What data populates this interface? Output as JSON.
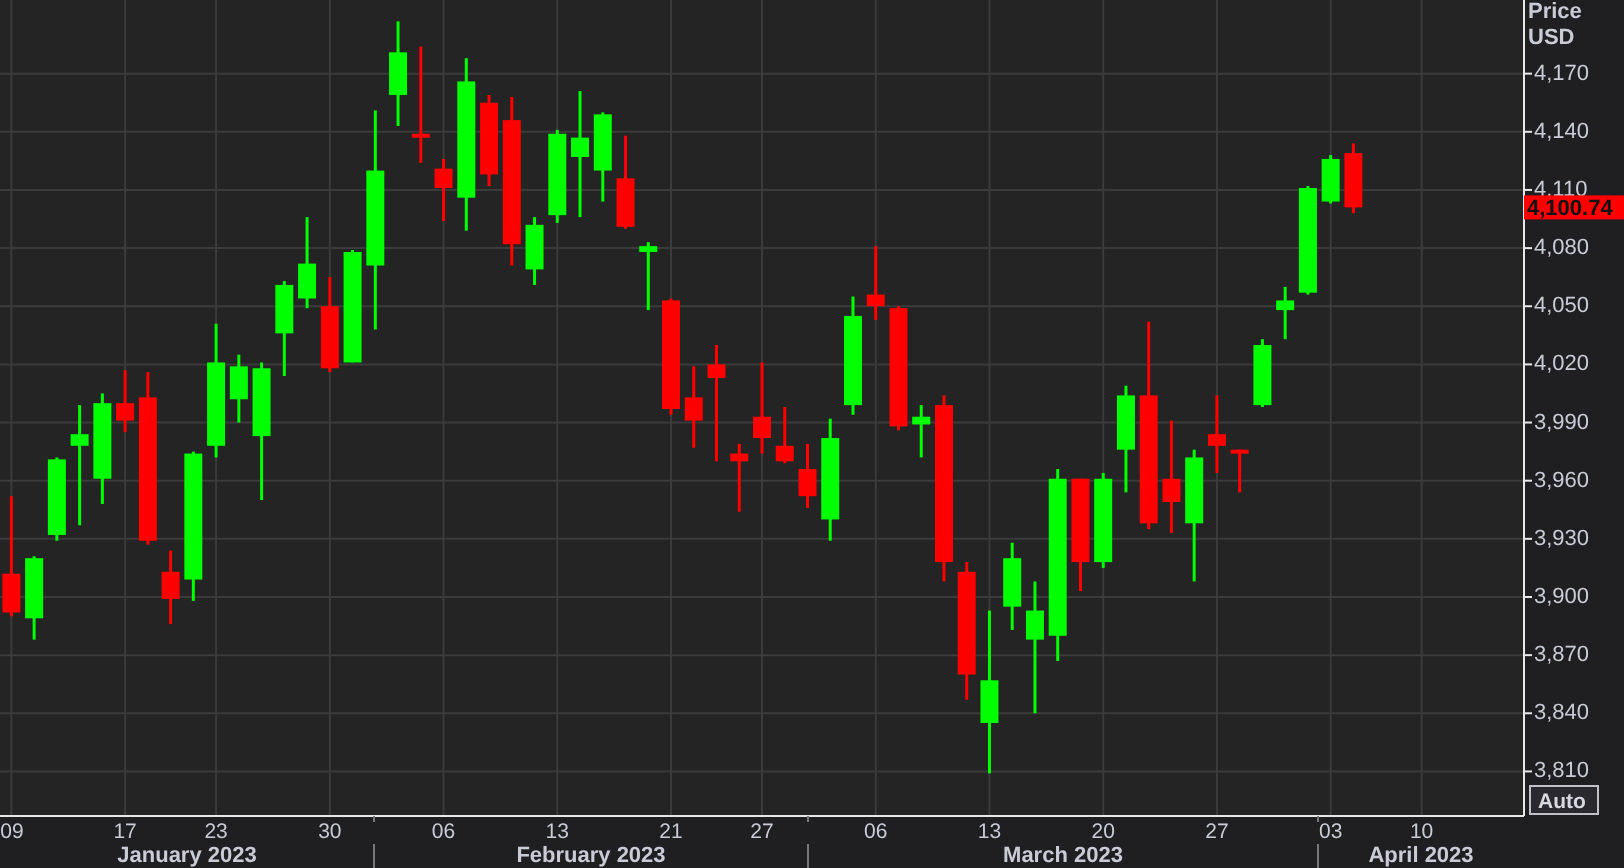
{
  "chart_data": {
    "type": "candlestick",
    "ylabel": "Price USD",
    "grid": true,
    "categories": [
      "09",
      null,
      null,
      null,
      null,
      "17",
      null,
      null,
      null,
      "23",
      null,
      null,
      null,
      null,
      "30",
      null,
      null,
      null,
      null,
      "06",
      null,
      null,
      null,
      null,
      "13",
      null,
      null,
      null,
      null,
      "21",
      null,
      null,
      null,
      "27",
      null,
      null,
      null,
      null,
      "06",
      null,
      null,
      null,
      null,
      "13",
      null,
      null,
      null,
      null,
      "20",
      null,
      null,
      null,
      null,
      "27",
      null,
      null,
      null,
      null,
      "03",
      null,
      null,
      null,
      "10",
      null,
      null,
      null,
      null
    ],
    "ohlc": [
      [
        3912,
        3952,
        3890,
        3892
      ],
      [
        3889,
        3921,
        3878,
        3920
      ],
      [
        3932,
        3972,
        3929,
        3971
      ],
      [
        3978,
        3999,
        3937,
        3984
      ],
      [
        3961,
        4005,
        3948,
        4000
      ],
      [
        4000,
        4017,
        3985,
        3991
      ],
      [
        4003,
        4016,
        3927,
        3929
      ],
      [
        3913,
        3924,
        3886,
        3899
      ],
      [
        3909,
        3975,
        3898,
        3974
      ],
      [
        3978,
        4041,
        3972,
        4021
      ],
      [
        4002,
        4025,
        3990,
        4019
      ],
      [
        3983,
        4021,
        3950,
        4018
      ],
      [
        4036,
        4063,
        4014,
        4061
      ],
      [
        4054,
        4096,
        4049,
        4072
      ],
      [
        4050,
        4065,
        4016,
        4018
      ],
      [
        4021,
        4079,
        4021,
        4078
      ],
      [
        4071,
        4151,
        4038,
        4120
      ],
      [
        4159,
        4197,
        4143,
        4181
      ],
      [
        4139,
        4184,
        4124,
        4137
      ],
      [
        4121,
        4126,
        4094,
        4111
      ],
      [
        4106,
        4178,
        4089,
        4166
      ],
      [
        4155,
        4159,
        4112,
        4118
      ],
      [
        4146,
        4158,
        4071,
        4082
      ],
      [
        4069,
        4096,
        4061,
        4092
      ],
      [
        4097,
        4141,
        4093,
        4139
      ],
      [
        4127,
        4161,
        4096,
        4137
      ],
      [
        4120,
        4150,
        4104,
        4149
      ],
      [
        4116,
        4138,
        4090,
        4091
      ],
      [
        4078,
        4083,
        4048,
        4081
      ],
      [
        4053,
        4054,
        3994,
        3997
      ],
      [
        4003,
        4019,
        3977,
        3991
      ],
      [
        4020,
        4030,
        3970,
        4013
      ],
      [
        3974,
        3979,
        3944,
        3970
      ],
      [
        3993,
        4021,
        3974,
        3982
      ],
      [
        3978,
        3998,
        3969,
        3970
      ],
      [
        3966,
        3979,
        3946,
        3952
      ],
      [
        3940,
        3992,
        3929,
        3982
      ],
      [
        3999,
        4055,
        3994,
        4045
      ],
      [
        4056,
        4081,
        4043,
        4050
      ],
      [
        4049,
        4050,
        3986,
        3988
      ],
      [
        3989,
        3999,
        3972,
        3993
      ],
      [
        3999,
        4004,
        3908,
        3918
      ],
      [
        3913,
        3918,
        3847,
        3860
      ],
      [
        3835,
        3893,
        3809,
        3857
      ],
      [
        3895,
        3928,
        3883,
        3920
      ],
      [
        3878,
        3908,
        3840,
        3893
      ],
      [
        3880,
        3966,
        3867,
        3961
      ],
      [
        3961,
        3961,
        3903,
        3918
      ],
      [
        3918,
        3964,
        3915,
        3961
      ],
      [
        3976,
        4009,
        3954,
        4004
      ],
      [
        4004,
        4042,
        3935,
        3938
      ],
      [
        3961,
        3991,
        3933,
        3949
      ],
      [
        3938,
        3976,
        3908,
        3972
      ],
      [
        3984,
        4004,
        3964,
        3978
      ],
      [
        3976,
        3976,
        3954,
        3974
      ],
      [
        3999,
        4033,
        3998,
        4030
      ],
      [
        4048,
        4060,
        4033,
        4053
      ],
      [
        4057,
        4112,
        4056,
        4111
      ],
      [
        4104,
        4128,
        4103,
        4126
      ],
      [
        4129,
        4134,
        4098,
        4101
      ],
      null,
      null,
      null,
      null,
      null,
      null,
      null
    ],
    "ylim": [
      3787,
      4208
    ],
    "yticks": [
      {
        "value": 4170,
        "label": "4,170"
      },
      {
        "value": 4140,
        "label": "4,140"
      },
      {
        "value": 4110,
        "label": "4,110"
      },
      {
        "value": 4080,
        "label": "4,080"
      },
      {
        "value": 4050,
        "label": "4,050"
      },
      {
        "value": 4020,
        "label": "4,020"
      },
      {
        "value": 3990,
        "label": "3,990"
      },
      {
        "value": 3960,
        "label": "3,960"
      },
      {
        "value": 3930,
        "label": "3,930"
      },
      {
        "value": 3900,
        "label": "3,900"
      },
      {
        "value": 3870,
        "label": "3,870"
      },
      {
        "value": 3840,
        "label": "3,840"
      },
      {
        "value": 3810,
        "label": "3,810"
      }
    ],
    "annotations": [
      "4,100.74"
    ]
  },
  "month_labels": [
    {
      "label": "January 2023"
    },
    {
      "label": "February 2023"
    },
    {
      "label": "March 2023"
    },
    {
      "label": "April 2023"
    }
  ],
  "auto_button": {
    "label": "Auto"
  }
}
